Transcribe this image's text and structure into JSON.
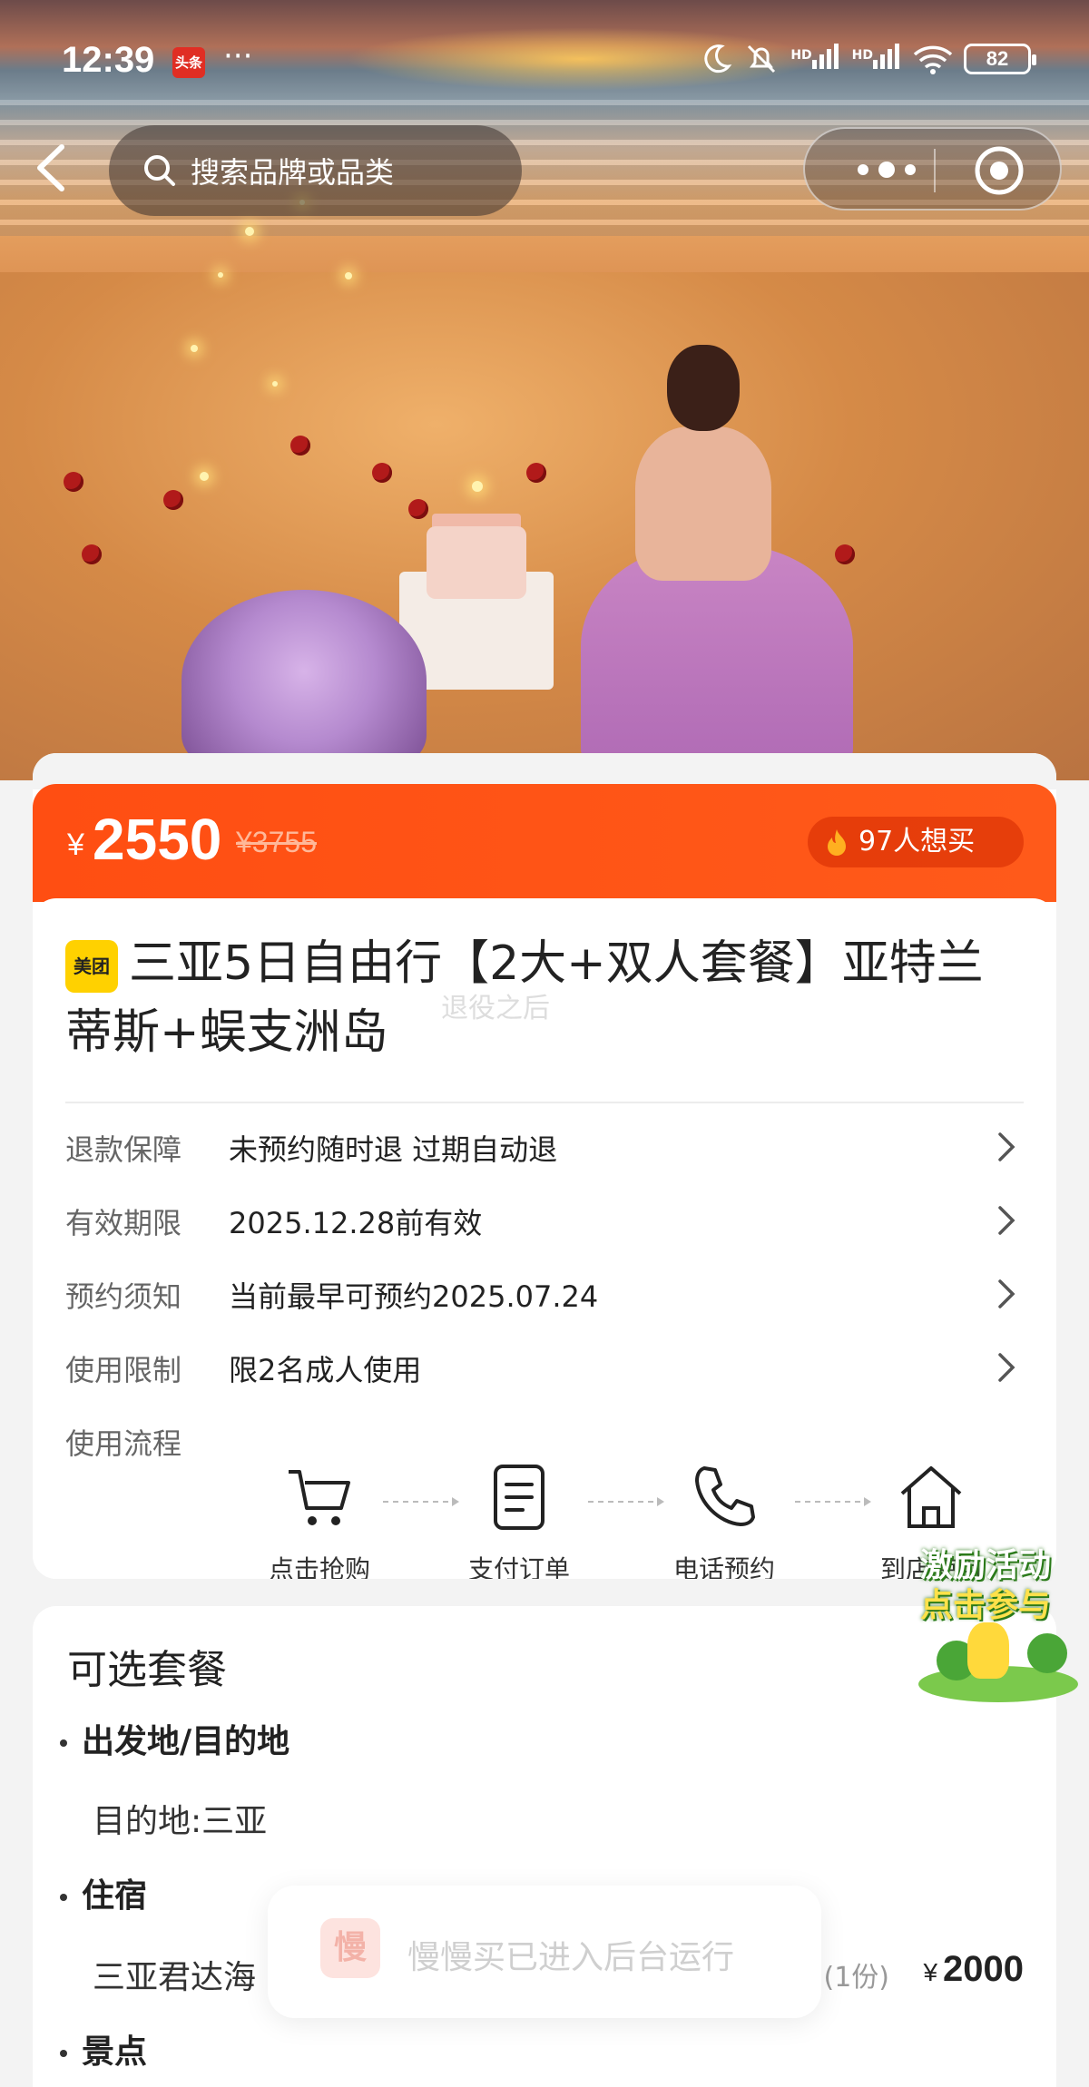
{
  "status_bar": {
    "time": "12:39",
    "app_badge": "头条",
    "more": "···",
    "hd1": "HD",
    "hd2": "HD",
    "battery": "82"
  },
  "nav": {
    "search_placeholder": "搜索品牌或品类"
  },
  "product": {
    "currency": "¥",
    "price": "2550",
    "original_price": "¥3755",
    "want_count": "97人想买",
    "brand_logo": "美团",
    "title": "三亚5日自由行【2大+双人套餐】亚特兰蒂斯+蜈支洲岛",
    "watermark": "退役之后",
    "rows": [
      {
        "label": "退款保障",
        "value": "未预约随时退 过期自动退"
      },
      {
        "label": "有效期限",
        "value": "2025.12.28前有效"
      },
      {
        "label": "预约须知",
        "value": "当前最早可预约2025.07.24"
      },
      {
        "label": "使用限制",
        "value": "限2名成人使用"
      }
    ],
    "flow_label": "使用流程",
    "flow_steps": [
      {
        "label": "点击抢购",
        "icon": "cart-icon"
      },
      {
        "label": "支付订单",
        "icon": "document-icon"
      },
      {
        "label": "电话预约",
        "icon": "phone-icon"
      },
      {
        "label": "到店使用",
        "icon": "home-icon"
      }
    ]
  },
  "promo": {
    "line1": "激励活动",
    "line2": "点击参与"
  },
  "packages": {
    "heading": "可选套餐",
    "sections": [
      {
        "title": "出发地/目的地",
        "detail": "目的地:三亚"
      },
      {
        "title": "住宿",
        "detail": "三亚君达海"
      },
      {
        "title": "景点"
      }
    ],
    "hotel_qty": "(1份)",
    "hotel_currency": "¥",
    "hotel_price": "2000"
  },
  "toast": {
    "icon_char": "慢",
    "message": "慢慢买已进入后台运行"
  },
  "colors": {
    "accent": "#ff5215",
    "brand_yellow": "#ffd100"
  }
}
